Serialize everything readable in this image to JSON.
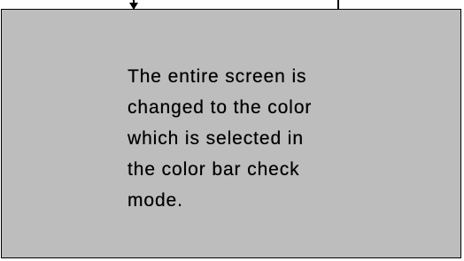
{
  "callout": {
    "lines": [
      "The entire screen is",
      "changed to the color",
      "which is selected in",
      "the color bar check",
      "mode."
    ]
  }
}
